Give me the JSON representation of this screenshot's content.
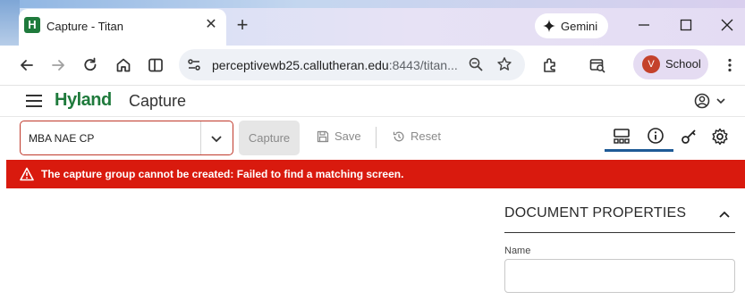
{
  "browser": {
    "tab": {
      "title": "Capture - Titan",
      "favicon_letter": "H"
    },
    "new_tab_label": "+",
    "gemini_label": "Gemini",
    "url": {
      "host": "perceptivewb25.callutheran.edu",
      "rest": ":8443/titan..."
    },
    "profile": {
      "initial": "V",
      "label": "School"
    }
  },
  "app": {
    "brand": "Hyland",
    "name": "Capture"
  },
  "toolbar": {
    "capture_group": {
      "selected": "MBA NAE CP"
    },
    "capture_label": "Capture",
    "save_label": "Save",
    "reset_label": "Reset",
    "icons": [
      "layout-icon",
      "info-icon",
      "key-icon",
      "gear-icon"
    ]
  },
  "error": {
    "message": "The capture group cannot be created: Failed to find a matching screen."
  },
  "document_properties": {
    "title": "DOCUMENT PROPERTIES",
    "name_label": "Name",
    "name_value": ""
  },
  "colors": {
    "brand_green": "#1f7a3c",
    "error_red": "#d91a0e",
    "active_tab_blue": "#1e5a96"
  }
}
